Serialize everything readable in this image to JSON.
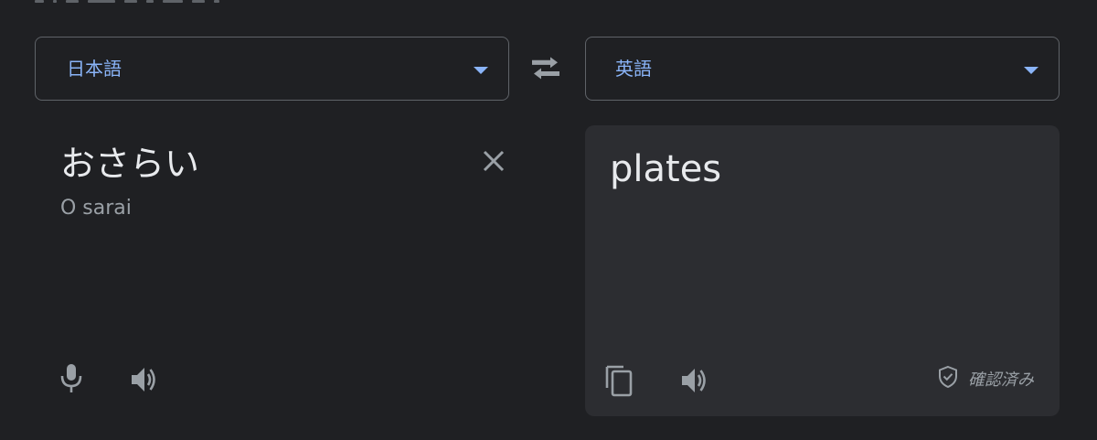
{
  "source_language": {
    "label": "日本語"
  },
  "target_language": {
    "label": "英語"
  },
  "source": {
    "text": "おさらい",
    "romanization": "O sarai"
  },
  "target": {
    "text": "plates",
    "verified_label": "確認済み"
  },
  "icons": {
    "swap": "swap-arrows-icon",
    "clear": "close-icon",
    "microphone": "microphone-icon",
    "source_speaker": "speaker-icon",
    "copy": "copy-icon",
    "target_speaker": "speaker-icon",
    "verified": "shield-check-icon"
  },
  "colors": {
    "background": "#1f2023",
    "panel": "#2c2d31",
    "accent": "#8ab4f8",
    "border": "#5f6368",
    "muted_text": "#9aa0a6",
    "text": "#e8eaed"
  }
}
